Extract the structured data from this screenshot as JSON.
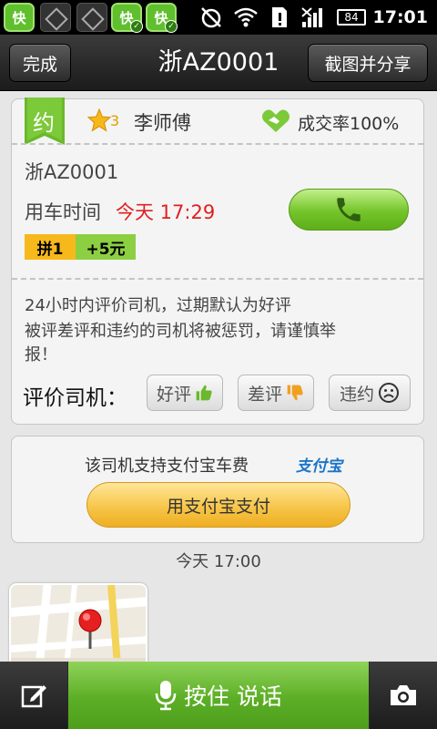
{
  "status_bar": {
    "app_letter": "快",
    "battery": "84",
    "time": "17:01"
  },
  "header": {
    "done_label": "完成",
    "title": "浙AZ0001",
    "share_label": "截图并分享"
  },
  "driver_card": {
    "badge": "约",
    "star_count": "3",
    "driver_name": "李师傅",
    "deal_rate_label": "成交率100%",
    "plate": "浙AZ0001",
    "time_label": "用车时间",
    "time_value": "今天 17:29",
    "tag_carpool": "拼1",
    "tag_bonus": "+5元",
    "notice_line1": "24小时内评价司机，过期默认为好评",
    "notice_line2": "被评差评和违约的司机将被惩罚，请谨慎举",
    "notice_line3": "报！",
    "rate_label": "评价司机：",
    "good_label": "好评",
    "bad_label": "差评",
    "breach_label": "违约"
  },
  "pay_card": {
    "text": "该司机支持支付宝车费",
    "logo_text": "支付宝",
    "button_label": "用支付宝支付"
  },
  "message_time": "今天 17:00",
  "bottom_bar": {
    "talk_label": "按住  说话"
  },
  "colors": {
    "accent_green": "#5cae26",
    "time_red": "#e02020",
    "pay_orange": "#f7c64a"
  }
}
